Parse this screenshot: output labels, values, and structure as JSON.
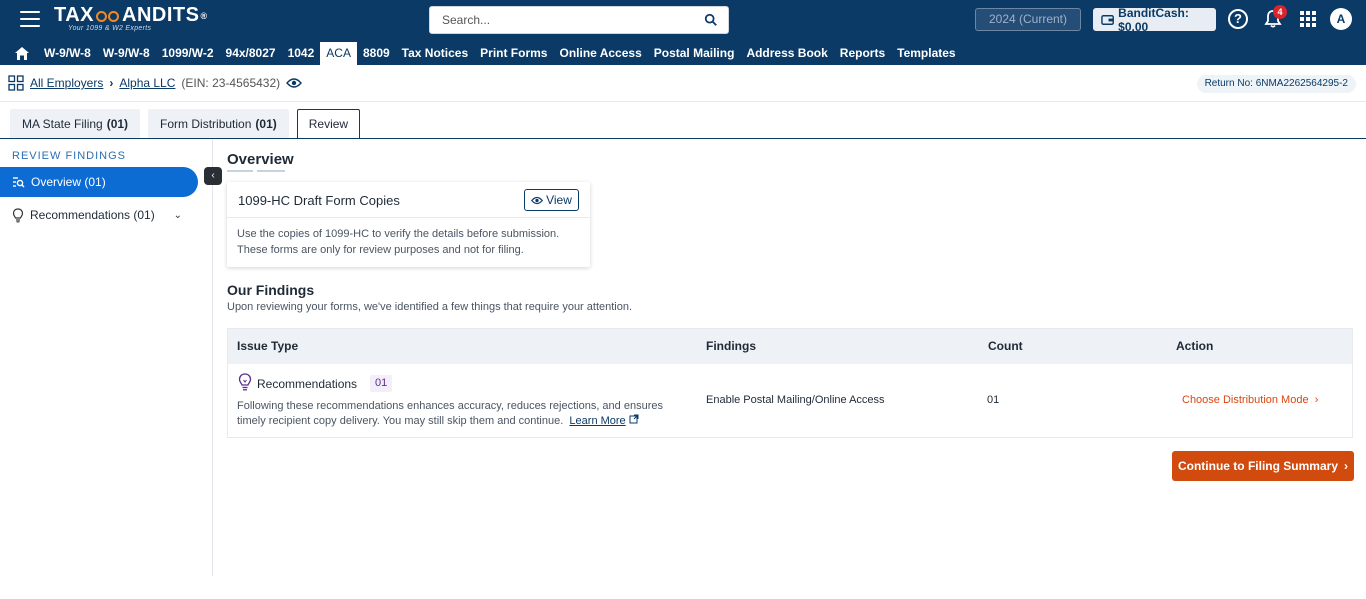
{
  "header": {
    "logo_text": "TAXBANDITS",
    "logo_tagline": "Your 1099 & W2 Experts",
    "search_placeholder": "Search...",
    "year_label": "2024 (Current)",
    "bandit_cash_label": "BanditCash: $0.00",
    "help_label": "?",
    "notification_count": "4",
    "avatar_initial": "A"
  },
  "nav": {
    "items": [
      "W-9/W-8",
      "W-9/W-8",
      "1099/W-2",
      "94x/8027",
      "1042",
      "ACA",
      "8809",
      "Tax Notices",
      "Print Forms",
      "Online Access",
      "Postal Mailing",
      "Address Book",
      "Reports",
      "Templates"
    ],
    "active": "ACA"
  },
  "breadcrumb": {
    "all_employers": "All Employers",
    "employer": "Alpha LLC",
    "ein": "(EIN: 23-4565432)",
    "return_no": "Return No: 6NMA2262564295-2"
  },
  "tabs": [
    {
      "label": "MA State Filing",
      "count": "(01)"
    },
    {
      "label": "Form Distribution",
      "count": "(01)"
    },
    {
      "label": "Review",
      "count": ""
    }
  ],
  "sidebar": {
    "title": "REVIEW FINDINGS",
    "active_item": "Overview (01)",
    "item_recommendations": "Recommendations (01)"
  },
  "overview": {
    "heading": "Overview",
    "card_title": "1099-HC Draft Form Copies",
    "view_button": "View",
    "card_desc_1": "Use the copies of 1099-HC to verify the details before submission.",
    "card_desc_2": "These forms are only for review purposes and not for filing."
  },
  "findings": {
    "heading": "Our Findings",
    "subtitle": "Upon reviewing your forms, we've identified a few things that require your attention.",
    "columns": [
      "Issue Type",
      "Findings",
      "Count",
      "Action"
    ],
    "row": {
      "title": "Recommendations",
      "badge": "01",
      "desc_1": "Following these recommendations enhances accuracy, reduces rejections, and ensures",
      "desc_2": "timely recipient copy delivery. You may still skip them and continue.",
      "learn_more": "Learn More",
      "finding": "Enable Postal Mailing/Online Access",
      "count": "01",
      "action": "Choose Distribution Mode"
    }
  },
  "continue_button": "Continue to Filing Summary",
  "colors": {
    "brand_navy": "#0b3a66",
    "accent_blue": "#0d6bd4",
    "action_orange": "#d14a0e"
  }
}
